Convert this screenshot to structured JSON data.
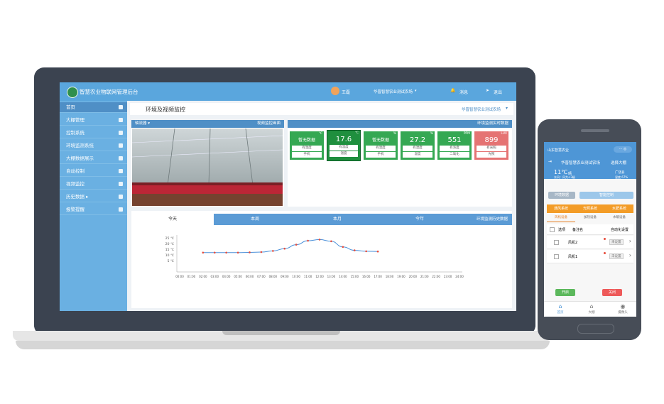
{
  "laptop": {
    "app_title": "智慧农业物联网管理后台",
    "user": "王磊",
    "farm_selector": "华晋智慧农业测试农场",
    "message_label": "消息",
    "logout_label": "退出",
    "sidebar": [
      {
        "label": "首页",
        "icon": "home-icon"
      },
      {
        "label": "大棚管理",
        "icon": "greenhouse-icon"
      },
      {
        "label": "控制系统",
        "icon": "control-icon"
      },
      {
        "label": "环境监测系统",
        "icon": "monitor-icon"
      },
      {
        "label": "大棚数据展示",
        "icon": "data-icon"
      },
      {
        "label": "自动控制",
        "icon": "auto-icon"
      },
      {
        "label": "视频监控",
        "icon": "video-icon"
      },
      {
        "label": "历史数据 ▸",
        "icon": "history-icon"
      },
      {
        "label": "报警提醒",
        "icon": "alert-icon"
      }
    ],
    "page_title": "环境及视频监控",
    "page_farm": "华晋智慧农业测试农场",
    "video": {
      "selector": "轴流器",
      "link": "视频监控画面"
    },
    "env_panel_title": "环境监测实时数据",
    "tiles": [
      {
        "value": "暂无数据",
        "unit": "℃",
        "line1": "有温度",
        "line2": "手机",
        "color": "#35a853"
      },
      {
        "value": "17.6",
        "unit": "℃",
        "line1": "有温度",
        "line2": "温度",
        "color": "#1f8f3e"
      },
      {
        "value": "暂无数据",
        "unit": "%",
        "line1": "有温度",
        "line2": "手机",
        "color": "#35a853"
      },
      {
        "value": "27.2",
        "unit": "%",
        "line1": "有湿度",
        "line2": "湿度",
        "color": "#35a853"
      },
      {
        "value": "551",
        "unit": "PPM",
        "line1": "有浓度",
        "line2": "二氧化",
        "color": "#35a853"
      },
      {
        "value": "899",
        "unit": "LUX",
        "line1": "有光照",
        "line2": "光照",
        "color": "#e57373"
      }
    ],
    "history_tabs": [
      "今天",
      "本周",
      "本月",
      "今年"
    ],
    "history_link": "环境监测历史数据"
  },
  "chart_data": {
    "type": "line",
    "x": [
      "00:00",
      "01:00",
      "02:00",
      "03:00",
      "04:00",
      "05:00",
      "06:00",
      "07:00",
      "08:00",
      "09:00",
      "10:00",
      "11:00",
      "12:00",
      "13:00",
      "14:00",
      "15:00",
      "16:00",
      "17:00",
      "18:00",
      "19:00",
      "20:00",
      "21:00",
      "22:00",
      "23:00",
      "24:00"
    ],
    "series": [
      {
        "values": [
          null,
          null,
          12,
          12,
          12,
          12,
          12.2,
          12.5,
          13.5,
          15.5,
          19,
          22.5,
          23.5,
          22,
          17,
          14,
          13.2,
          13,
          null,
          null,
          null,
          null,
          null,
          null,
          null
        ]
      }
    ],
    "yticks": [
      "25 ℃",
      "20 ℃",
      "15 ℃",
      "10 ℃",
      "5 ℃"
    ],
    "ylim": [
      0,
      25
    ],
    "color": "#4a90d9"
  },
  "phone": {
    "app_title": "山东智慧农业",
    "farm_line": "华晋智慧农业测试农场",
    "select_link": "选择大棚",
    "temp": "11℃",
    "weather": "晴",
    "wind": "东风：风力<3级",
    "location": "广饶县",
    "humidity": "湿度 67%",
    "btn_env": "环境数据",
    "btn_ctrl": "智能控制",
    "tabs": [
      "通风系统",
      "光照系统",
      "水肥系统"
    ],
    "subtabs": [
      "风机设备",
      "加热设备",
      "水暖设备"
    ],
    "table_head": [
      "选项",
      "备注名",
      "自动化设置"
    ],
    "rows": [
      {
        "name": "风机2",
        "btn": "未设置"
      },
      {
        "name": "风机1",
        "btn": "未设置"
      }
    ],
    "open_label": "开启",
    "close_label": "关闭",
    "nav": [
      "首页",
      "大棚",
      "摄像头"
    ]
  }
}
